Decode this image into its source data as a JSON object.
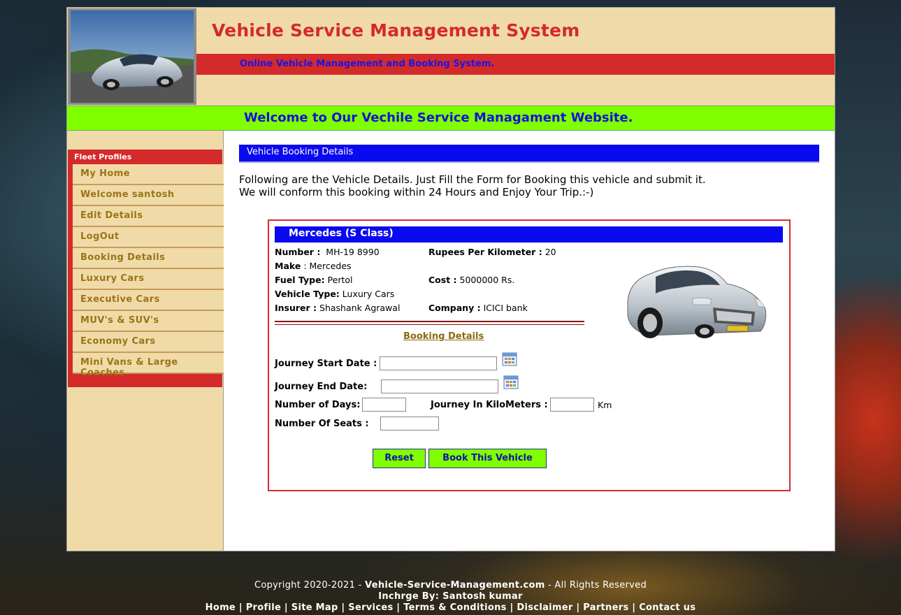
{
  "header": {
    "title": "Vehicle Service Management System",
    "subtitle": "Online Vehicle Management and Booking System.",
    "welcome": "Welcome to Our Vechile Service Managament Website."
  },
  "sidebar": {
    "title": "Fleet Profiles",
    "items": [
      {
        "label": "My Home"
      },
      {
        "label": "Welcome santosh"
      },
      {
        "label": "Edit Details"
      },
      {
        "label": "LogOut"
      },
      {
        "label": "Booking Details"
      },
      {
        "label": "Luxury Cars"
      },
      {
        "label": "Executive Cars"
      },
      {
        "label": "MUV's & SUV's"
      },
      {
        "label": "Economy Cars"
      },
      {
        "label": "Mini Vans & Large Coaches"
      }
    ]
  },
  "main": {
    "section_title": "Vehicle Booking Details",
    "intro_line1": "Following are the Vehicle Details. Just Fill the Form for Booking this vehicle and submit it.",
    "intro_line2": "We will conform this booking within 24 Hours and Enjoy Your Trip.:-)"
  },
  "vehicle": {
    "name": "Mercedes (S Class)",
    "number_label": "Number :",
    "number": "MH-19 8990",
    "rate_label": "Rupees Per Kilometer :",
    "rate": "20",
    "make_label": "Make",
    "make": ": Mercedes",
    "fuel_label": "Fuel Type:",
    "fuel": "Pertol",
    "cost_label": "Cost :",
    "cost": "5000000 Rs.",
    "type_label": "Vehicle Type:",
    "type": "Luxury Cars",
    "insurer_label": "Insurer :",
    "insurer": "Shashank Agrawal",
    "company_label": "Company :",
    "company": "ICICI bank"
  },
  "form": {
    "heading": "Booking Details",
    "start_label": "Journey Start Date :",
    "start_value": "",
    "end_label": "Journey End Date:",
    "end_value": "",
    "days_label": "Number of Days:",
    "days_value": "",
    "km_label": "Journey In KiloMeters :",
    "km_value": "",
    "km_unit": "Km",
    "seats_label": "Number Of Seats :",
    "seats_value": "",
    "reset_label": "Reset",
    "book_label": "Book This Vehicle"
  },
  "footer": {
    "copyright_prefix": "Copyright 2020-2021 -",
    "site": "Vehicle-Service-Management.com",
    "copyright_suffix": "- All Rights Reserved",
    "incharge": "Inchrge By: Santosh kumar",
    "links": [
      "Home",
      "Profile",
      "Site Map",
      "Services",
      "Terms & Conditions",
      "Disclaimer",
      "Partners",
      "Contact us"
    ]
  },
  "colors": {
    "brand_red": "#d42a2a",
    "header_tan": "#f0dba8",
    "accent_green": "#80ff00",
    "bar_blue": "#0a0af0"
  }
}
